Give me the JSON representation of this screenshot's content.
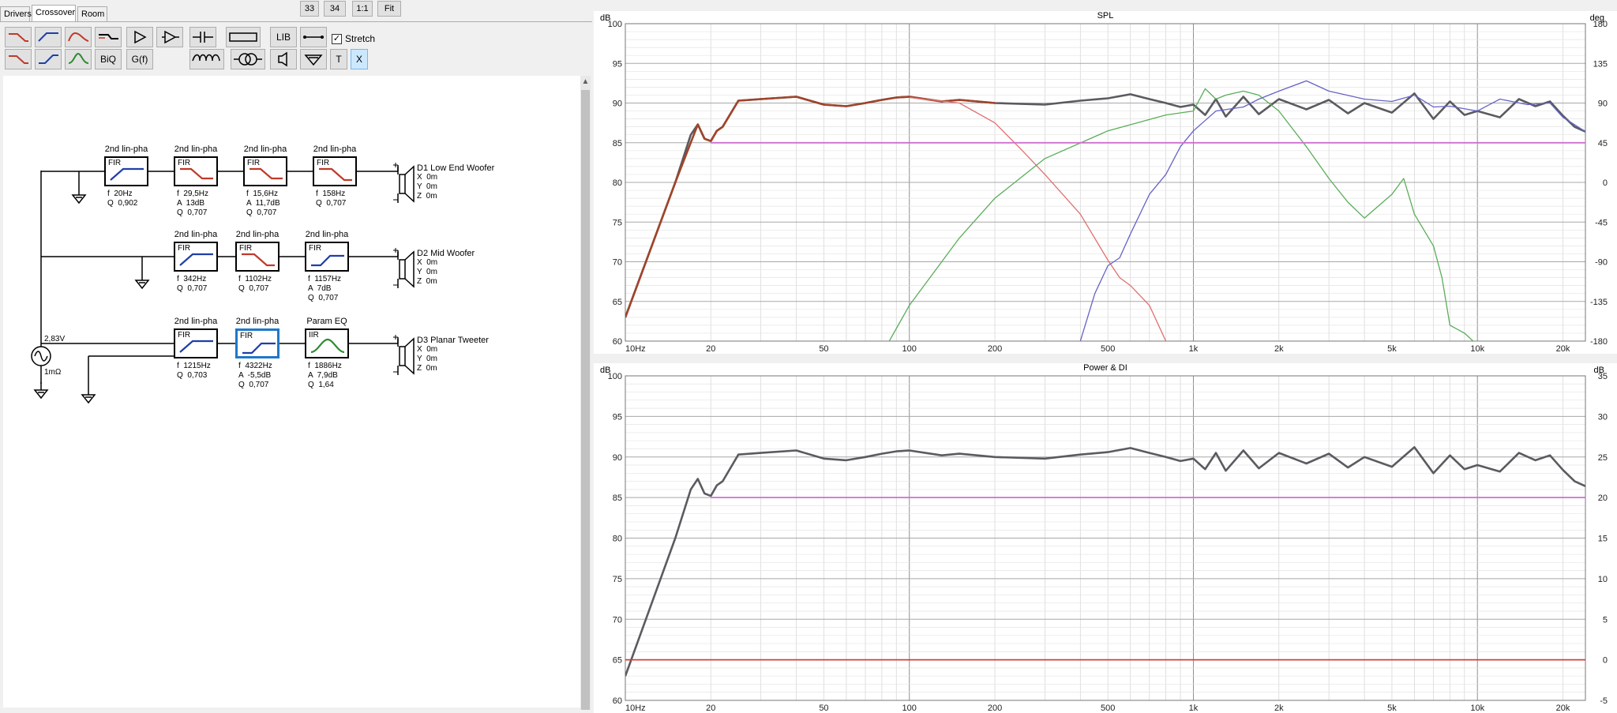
{
  "tabs": [
    "Drivers",
    "Crossover",
    "Room"
  ],
  "active_tab": "Crossover",
  "top_buttons": [
    "33",
    "34",
    "1:1",
    "Fit"
  ],
  "toolbar": {
    "lib_label": "LIB",
    "biq_label": "BiQ",
    "gf_label": "G(f)",
    "t_label": "T",
    "x_label": "X",
    "stretch_label": "Stretch",
    "stretch_checked": "✓"
  },
  "colors": {
    "red": "#c0392b",
    "blue": "#1f3fa8",
    "green": "#2e8b2e",
    "sel": "#1e78c8",
    "brown": "#a0442a",
    "gray_sum": "#5a5a60",
    "salmon": "#e07070",
    "lgreen": "#5aad5a",
    "lblue": "#6464c8",
    "magenta": "#d070d0",
    "red_line": "#d04040"
  },
  "circuit": {
    "source": {
      "voltage": "2,83V",
      "impedance": "1mΩ"
    },
    "rows": [
      {
        "blocks": [
          {
            "title": "2nd lin-pha",
            "type": "FIR",
            "params": "f  20Hz\nQ  0,902",
            "shape": "hp",
            "color": "blue"
          },
          {
            "title": "2nd lin-pha",
            "type": "FIR",
            "params": "f  29,5Hz\nA  13dB\nQ  0,707",
            "shape": "lshelf",
            "color": "red"
          },
          {
            "title": "2nd lin-pha",
            "type": "FIR",
            "params": "f  15,6Hz\nA  11,7dB\nQ  0,707",
            "shape": "lshelf",
            "color": "red"
          },
          {
            "title": "2nd lin-pha",
            "type": "FIR",
            "params": "f  158Hz\nQ  0,707",
            "shape": "lp",
            "color": "red"
          }
        ],
        "driver": {
          "name": "D1 Low End Woofer",
          "xyz": "X  0m\nY  0m\nZ  0m"
        }
      },
      {
        "blocks": [
          {
            "title": "2nd lin-pha",
            "type": "FIR",
            "params": "f  342Hz\nQ  0,707",
            "shape": "hp",
            "color": "blue"
          },
          {
            "title": "2nd lin-pha",
            "type": "FIR",
            "params": "f  1102Hz\nQ  0,707",
            "shape": "lp",
            "color": "red"
          },
          {
            "title": "2nd lin-pha",
            "type": "FIR",
            "params": "f  1157Hz\nA  7dB\nQ  0,707",
            "shape": "hshelf",
            "color": "blue"
          }
        ],
        "driver": {
          "name": "D2 Mid Woofer",
          "xyz": "X  0m\nY  0m\nZ  0m"
        }
      },
      {
        "blocks": [
          {
            "title": "2nd lin-pha",
            "type": "FIR",
            "params": "f  1215Hz\nQ  0,703",
            "shape": "hp",
            "color": "blue"
          },
          {
            "title": "2nd lin-pha",
            "type": "FIR",
            "params": "f  4322Hz\nA  -5,5dB\nQ  0,707",
            "shape": "hshelf",
            "color": "blue",
            "selected": true
          },
          {
            "title": "Param EQ",
            "type": "IIR",
            "params": "f  1886Hz\nA  7,9dB\nQ  1,64",
            "shape": "peq",
            "color": "green"
          }
        ],
        "driver": {
          "name": "D3 Planar Tweeter",
          "xyz": "X  0m\nY  0m\nZ  0m"
        }
      }
    ]
  },
  "spl": {
    "title": "SPL",
    "left_unit": "dB",
    "right_unit": "deg",
    "y_ticks": [
      "100",
      "95",
      "90",
      "85",
      "80",
      "75",
      "70",
      "65",
      "60"
    ],
    "right_ticks": [
      "180",
      "135",
      "90",
      "45",
      "0",
      "-45",
      "-90",
      "-135",
      "-180"
    ],
    "x_ticks": [
      "10Hz",
      "20",
      "50",
      "100",
      "200",
      "500",
      "1k",
      "2k",
      "5k",
      "10k",
      "20k"
    ]
  },
  "power": {
    "title": "Power & DI",
    "left_unit": "dB",
    "right_unit": "dB",
    "y_ticks": [
      "100",
      "95",
      "90",
      "85",
      "80",
      "75",
      "70",
      "65",
      "60"
    ],
    "right_ticks": [
      "35",
      "30",
      "25",
      "20",
      "15",
      "10",
      "5",
      "0",
      "-5"
    ],
    "x_ticks": [
      "10Hz",
      "20",
      "50",
      "100",
      "200",
      "500",
      "1k",
      "2k",
      "5k",
      "10k",
      "20k"
    ]
  },
  "chart_data": [
    {
      "type": "line",
      "title": "SPL",
      "xlabel": "",
      "ylabel": "dB",
      "xscale": "log",
      "xlim": [
        10,
        24000
      ],
      "ylim": [
        60,
        100
      ],
      "y2lim": [
        -180,
        180
      ],
      "series": [
        {
          "color": "#5a5a60",
          "x": [
            10,
            15,
            17,
            18,
            19,
            20,
            21,
            22,
            25,
            30,
            40,
            50,
            60,
            70,
            80,
            90,
            100,
            130,
            150,
            200,
            300,
            400,
            500,
            600,
            700,
            800,
            900,
            1000,
            1100,
            1200,
            1300,
            1500,
            1700,
            2000,
            2500,
            3000,
            3500,
            4000,
            5000,
            6000,
            7000,
            8000,
            9000,
            10000,
            12000,
            14000,
            16000,
            18000,
            20000,
            22000,
            24000
          ],
          "y": [
            63,
            80,
            86,
            87.3,
            85.5,
            85.2,
            86.5,
            87,
            90.3,
            90.5,
            90.8,
            89.8,
            89.6,
            90,
            90.4,
            90.7,
            90.8,
            90.2,
            90.4,
            90,
            89.8,
            90.3,
            90.6,
            91.1,
            90.5,
            90,
            89.5,
            89.8,
            88.5,
            90.5,
            88.3,
            90.8,
            88.6,
            90.5,
            89.2,
            90.4,
            88.7,
            90,
            88.8,
            91.2,
            88,
            90.2,
            88.5,
            89,
            88.2,
            90.5,
            89.6,
            90.2,
            88.4,
            87,
            86.4
          ]
        },
        {
          "color": "#a0442a",
          "x": [
            10,
            15,
            18,
            19,
            20,
            21,
            22,
            25,
            30,
            40,
            50,
            60,
            70,
            80,
            90,
            100,
            130,
            150,
            200
          ],
          "y": [
            63,
            80,
            87.3,
            85.5,
            85.2,
            86.5,
            87,
            90.3,
            90.5,
            90.8,
            89.8,
            89.6,
            90,
            90.4,
            90.7,
            90.8,
            90.2,
            90.4,
            90
          ]
        },
        {
          "color": "#e07070",
          "x": [
            100,
            150,
            200,
            250,
            300,
            400,
            500,
            550,
            600,
            700,
            800
          ],
          "y": [
            90.7,
            90,
            87.5,
            84,
            81,
            76,
            70.2,
            68,
            67,
            64.5,
            60
          ]
        },
        {
          "color": "#5aad5a",
          "x": [
            85,
            100,
            150,
            200,
            300,
            500,
            800,
            1000,
            1100,
            1200,
            1300,
            1500,
            1700,
            2000,
            2500,
            3000,
            3500,
            4000,
            5000,
            5500,
            6000,
            7000,
            7500,
            8000,
            9000,
            10000
          ],
          "y": [
            60,
            64.5,
            73,
            78,
            83,
            86.5,
            88.5,
            89,
            91.8,
            90.5,
            91,
            91.5,
            91,
            89,
            84.5,
            80.5,
            77.5,
            75.5,
            78.5,
            80.5,
            76,
            72,
            68,
            62,
            61,
            59.5
          ]
        },
        {
          "color": "#6464c8",
          "x": [
            400,
            450,
            500,
            550,
            600,
            700,
            800,
            900,
            1000,
            1200,
            1500,
            1700,
            2000,
            2500,
            3000,
            4000,
            5000,
            6000,
            7000,
            8000,
            10000,
            12000,
            15000,
            18000,
            20000,
            24000
          ],
          "y": [
            60,
            66,
            69.5,
            70.5,
            73.5,
            78.5,
            81,
            84.5,
            86.5,
            89,
            89.5,
            90.5,
            91.5,
            92.8,
            91.5,
            90.5,
            90.2,
            91,
            89.5,
            89.6,
            89,
            90.5,
            89.8,
            90,
            88.2,
            86.4
          ]
        },
        {
          "color": "#d070d0",
          "x": [
            20,
            24000
          ],
          "y": [
            85,
            85
          ]
        }
      ]
    },
    {
      "type": "line",
      "title": "Power & DI",
      "xlabel": "",
      "ylabel": "dB",
      "xscale": "log",
      "xlim": [
        10,
        24000
      ],
      "ylim": [
        60,
        100
      ],
      "y2lim": [
        -5,
        35
      ],
      "series": [
        {
          "color": "#5a5a60",
          "x": [
            10,
            15,
            17,
            18,
            19,
            20,
            21,
            22,
            25,
            30,
            40,
            50,
            60,
            70,
            80,
            90,
            100,
            130,
            150,
            200,
            300,
            400,
            500,
            600,
            700,
            800,
            900,
            1000,
            1100,
            1200,
            1300,
            1500,
            1700,
            2000,
            2500,
            3000,
            3500,
            4000,
            5000,
            6000,
            7000,
            8000,
            9000,
            10000,
            12000,
            14000,
            16000,
            18000,
            20000,
            22000,
            24000
          ],
          "y": [
            63,
            80,
            86,
            87.3,
            85.5,
            85.2,
            86.5,
            87,
            90.3,
            90.5,
            90.8,
            89.8,
            89.6,
            90,
            90.4,
            90.7,
            90.8,
            90.2,
            90.4,
            90,
            89.8,
            90.3,
            90.6,
            91.1,
            90.5,
            90,
            89.5,
            89.8,
            88.5,
            90.5,
            88.3,
            90.8,
            88.6,
            90.5,
            89.2,
            90.4,
            88.7,
            90,
            88.8,
            91.2,
            88,
            90.2,
            88.5,
            89,
            88.2,
            90.5,
            89.6,
            90.2,
            88.4,
            87,
            86.4
          ]
        },
        {
          "color": "#d070d0",
          "x": [
            20,
            24000
          ],
          "y": [
            85,
            85
          ]
        },
        {
          "color": "#d04040",
          "x": [
            10,
            24000
          ],
          "y": [
            65,
            65
          ]
        }
      ]
    }
  ]
}
